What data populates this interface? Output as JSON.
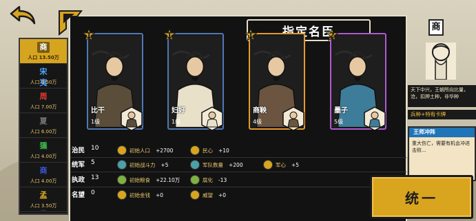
{
  "dialog": {
    "title": "指定名臣"
  },
  "dynasties": [
    {
      "glyph": "商",
      "pop": "人口 13.50万",
      "glyph_color": "#ffffff",
      "glyph_bg": "#7a5b10",
      "active": true
    },
    {
      "glyph": "宋夷",
      "pop": "人口 9.50万",
      "glyph_color": "#4fa3ff",
      "glyph_bg": "#161616",
      "active": false
    },
    {
      "glyph": "周",
      "pop": "人口 7.00万",
      "glyph_color": "#e53935",
      "glyph_bg": "#161616",
      "active": false
    },
    {
      "glyph": "夏",
      "pop": "人口 6.00万",
      "glyph_color": "#777777",
      "glyph_bg": "#161616",
      "active": false
    },
    {
      "glyph": "獯",
      "pop": "人口 4.00万",
      "glyph_color": "#3bb24a",
      "glyph_bg": "#161616",
      "active": false
    },
    {
      "glyph": "商",
      "pop": "人口 4.00万",
      "glyph_color": "#3b57d6",
      "glyph_bg": "#161616",
      "active": false
    },
    {
      "glyph": "孟",
      "pop": "人口 3.50万",
      "glyph_color": "#e5b224",
      "glyph_bg": "#161616",
      "active": false
    }
  ],
  "dyn_more": "...",
  "cards": [
    {
      "name": "比干",
      "level": "1级",
      "rank": "1",
      "border": "#4e79b6"
    },
    {
      "name": "妇好",
      "level": "1级",
      "rank": "1",
      "border": "#4e79b6"
    },
    {
      "name": "商鞅",
      "level": "4级",
      "rank": "1",
      "border": "#e69a2c"
    },
    {
      "name": "墨子",
      "level": "5级",
      "rank": "2",
      "border": "#b05bd1"
    }
  ],
  "stats": [
    {
      "label": "治民",
      "value": "10",
      "effects": [
        {
          "name": "初始人口",
          "val": "+2700",
          "color": "#d9a41e"
        },
        {
          "name": "民心",
          "val": "+10",
          "color": "#d9a41e"
        }
      ]
    },
    {
      "label": "统军",
      "value": "5",
      "effects": [
        {
          "name": "初始战斗力",
          "val": "+5",
          "color": "#4aa0a8"
        },
        {
          "name": "军队数量",
          "val": "+200",
          "color": "#4aa0a8"
        },
        {
          "name": "军心",
          "val": "+5",
          "color": "#d9a41e"
        }
      ]
    },
    {
      "label": "执政",
      "value": "13",
      "effects": [
        {
          "name": "初始粮食",
          "val": "+22.10万",
          "color": "#7fb040"
        },
        {
          "name": "腐化",
          "val": "-13",
          "color": "#7fb040"
        }
      ]
    },
    {
      "label": "名望",
      "value": "0",
      "effects": [
        {
          "name": "初始金钱",
          "val": "+0",
          "color": "#d9a41e"
        },
        {
          "name": "威望",
          "val": "+0",
          "color": "#d9a41e"
        }
      ]
    }
  ],
  "right_panel": {
    "tag": "商",
    "desc": "天下中兴，王朝所向比量，沧，扣押土种，非华种",
    "sub": "兵种+特有卡牌",
    "event_title": "王师冲阵",
    "event_text": "重大伤亡，需要有机会冲进击败..."
  },
  "unify_button": {
    "label": "统一"
  }
}
